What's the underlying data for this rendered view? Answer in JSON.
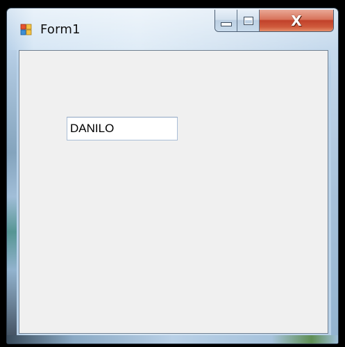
{
  "window": {
    "title": "Form1",
    "icon": "winforms-app-icon",
    "controls": {
      "minimize_icon": "minimize-icon",
      "maximize_icon": "maximize-icon",
      "close_icon": "close-icon",
      "close_label": "X"
    }
  },
  "form": {
    "textbox_value": "DANILO"
  },
  "colors": {
    "client_background": "#f0f0f0",
    "close_button": "#c1412a",
    "frame": "#cfe2f3"
  }
}
